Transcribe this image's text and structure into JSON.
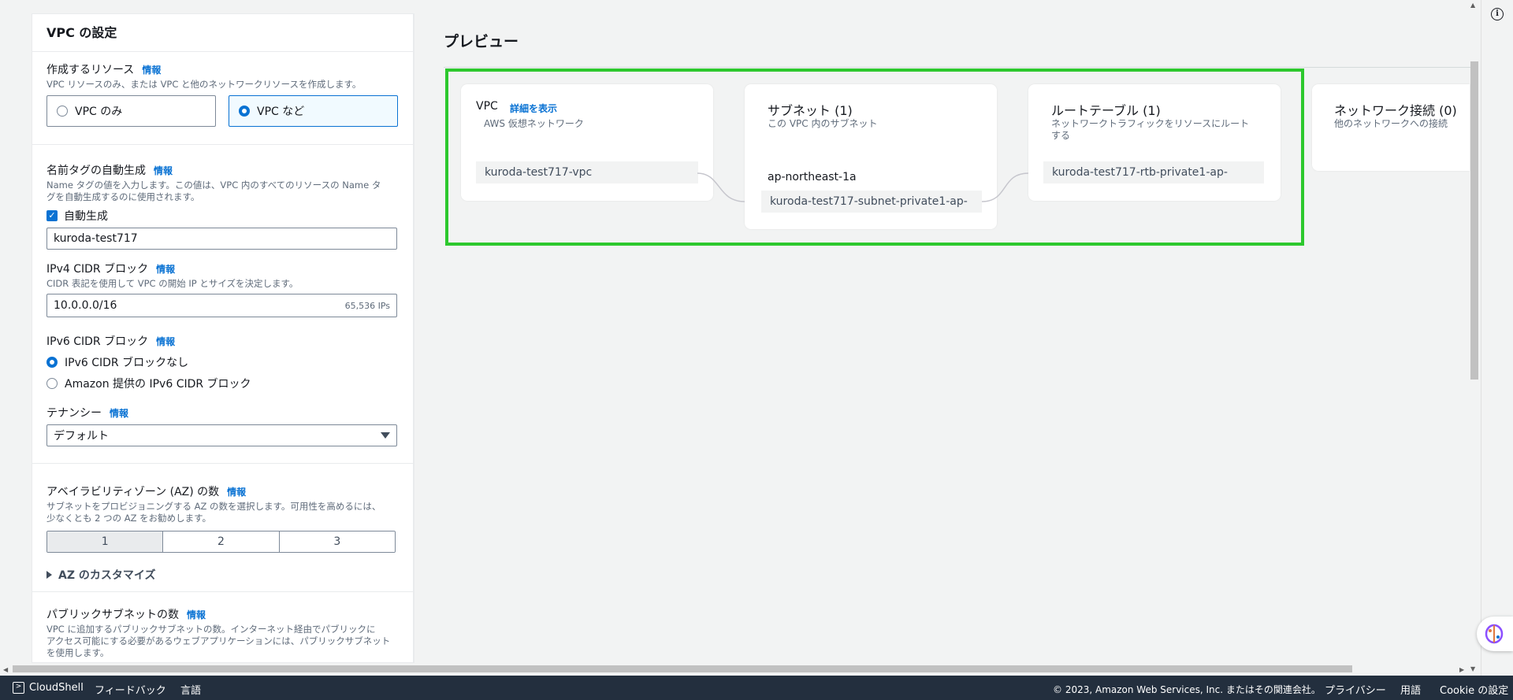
{
  "left_panel": {
    "title": "VPC の設定",
    "resources": {
      "label": "作成するリソース",
      "info": "情報",
      "description": "VPC リソースのみ、または VPC と他のネットワークリソースを作成します。",
      "options": [
        "VPC のみ",
        "VPC など"
      ],
      "selected": "VPC など"
    },
    "name_tag": {
      "label": "名前タグの自動生成",
      "info": "情報",
      "description_line1": "Name タグの値を入力します。この値は、VPC 内のすべてのリソースの Name タ",
      "description_line2": "グを自動生成するのに使用されます。",
      "checkbox_label": "自動生成",
      "value": "kuroda-test717"
    },
    "ipv4": {
      "label": "IPv4 CIDR ブロック",
      "info": "情報",
      "description": "CIDR 表記を使用して VPC の開始 IP とサイズを決定します。",
      "value": "10.0.0.0/16",
      "suffix": "65,536 IPs"
    },
    "ipv6": {
      "label": "IPv6 CIDR ブロック",
      "info": "情報",
      "options": [
        "IPv6 CIDR ブロックなし",
        "Amazon 提供の IPv6 CIDR ブロック"
      ],
      "selected": "IPv6 CIDR ブロックなし"
    },
    "tenancy": {
      "label": "テナンシー",
      "info": "情報",
      "value": "デフォルト"
    },
    "az": {
      "label": "アベイラビリティゾーン (AZ) の数",
      "info": "情報",
      "description_line1": "サブネットをプロビジョニングする AZ の数を選択します。可用性を高めるには、",
      "description_line2": "少なくとも 2 つの AZ をお勧めします。",
      "options": [
        "1",
        "2",
        "3"
      ],
      "selected": "1",
      "customize": "AZ のカスタマイズ"
    },
    "public_subnets": {
      "label": "パブリックサブネットの数",
      "info": "情報",
      "description_line1": "VPC に追加するパブリックサブネットの数。インターネット経由でパブリックに",
      "description_line2": "アクセス可能にする必要があるウェブアプリケーションには、パブリックサブネット",
      "description_line3": "を使用します。"
    }
  },
  "preview": {
    "title": "プレビュー",
    "vpc_card": {
      "title": "VPC",
      "link": "詳細を表示",
      "subtitle": "AWS 仮想ネットワーク",
      "item": "kuroda-test717-vpc"
    },
    "subnet_card": {
      "title": "サブネット (1)",
      "subtitle": "この VPC 内のサブネット",
      "az": "ap-northeast-1a",
      "item": "kuroda-test717-subnet-private1-ap-"
    },
    "route_card": {
      "title": "ルートテーブル (1)",
      "subtitle_line1": "ネットワークトラフィックをリソースにルート",
      "subtitle_line2": "する",
      "item": "kuroda-test717-rtb-private1-ap-"
    },
    "network_card": {
      "title": "ネットワーク接続 (0)",
      "subtitle": "他のネットワークへの接続"
    },
    "highlight_color": "#2dc82d"
  },
  "footer": {
    "cloudshell": "CloudShell",
    "feedback": "フィードバック",
    "language": "言語",
    "copyright": "© 2023, Amazon Web Services, Inc. またはその関連会社。",
    "privacy": "プライバシー",
    "terms": "用語",
    "cookie": "Cookie の設定"
  },
  "icons": {
    "info": "info-circle-icon",
    "assistant": "assistant-icon",
    "cloudshell": "cloudshell-icon"
  }
}
